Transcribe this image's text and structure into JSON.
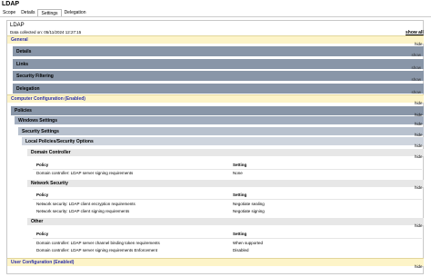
{
  "window": {
    "title": "LDAP"
  },
  "tabs": [
    "Scope",
    "Details",
    "Settings",
    "Delegation"
  ],
  "active_tab": "Settings",
  "report": {
    "title": "LDAP",
    "collected": "Data collected on: 05/11/2024 12:27:15",
    "show_all": "show all"
  },
  "links": {
    "hide": "hide",
    "show": "show"
  },
  "sections": {
    "general": "General",
    "details": "Details",
    "links": "Links",
    "security_filtering": "Security Filtering",
    "delegation": "Delegation",
    "computer_config": "Computer Configuration (Enabled)",
    "policies": "Policies",
    "windows_settings": "Windows Settings",
    "security_settings": "Security Settings",
    "local_policies": "Local Policies/Security Options",
    "user_config": "User Configuration (Enabled)"
  },
  "columns": {
    "policy": "Policy",
    "setting": "Setting"
  },
  "groups": [
    {
      "title": "Domain Controller",
      "rows": [
        {
          "policy": "Domain controller: LDAP server signing requirements",
          "setting": "None"
        }
      ]
    },
    {
      "title": "Network Security",
      "rows": [
        {
          "policy": "Network security: LDAP client encryption requirements",
          "setting": "Negotiate sealing"
        },
        {
          "policy": "Network security: LDAP client signing requirements",
          "setting": "Negotiate signing"
        }
      ]
    },
    {
      "title": "Other",
      "rows": [
        {
          "policy": "Domain controller: LDAP server channel binding token requirements",
          "setting": "When supported"
        },
        {
          "policy": "Domain controller: LDAP server signing requirements Enforcement",
          "setting": "Disabled"
        }
      ]
    }
  ]
}
